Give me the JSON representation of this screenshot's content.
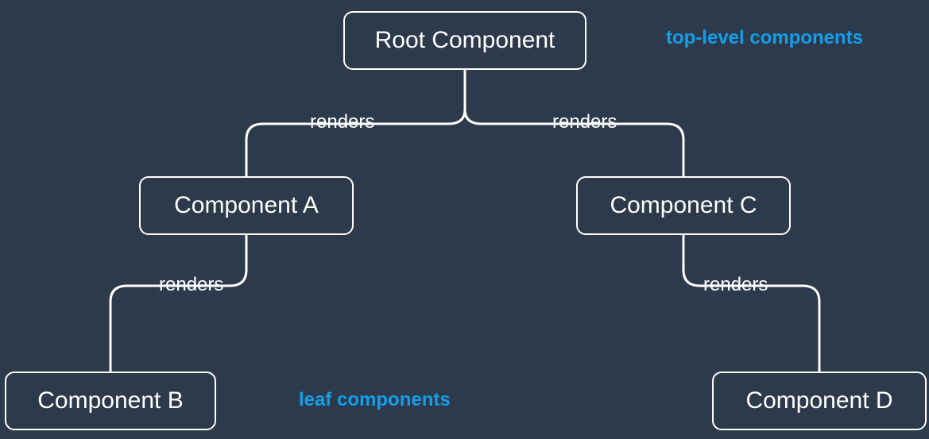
{
  "nodes": {
    "root": "Root Component",
    "a": "Component A",
    "b": "Component B",
    "c": "Component C",
    "d": "Component D"
  },
  "edges": {
    "root_a": "renders",
    "root_c": "renders",
    "a_b": "renders",
    "c_d": "renders"
  },
  "annotations": {
    "top": "top-level components",
    "leaf": "leaf components"
  }
}
